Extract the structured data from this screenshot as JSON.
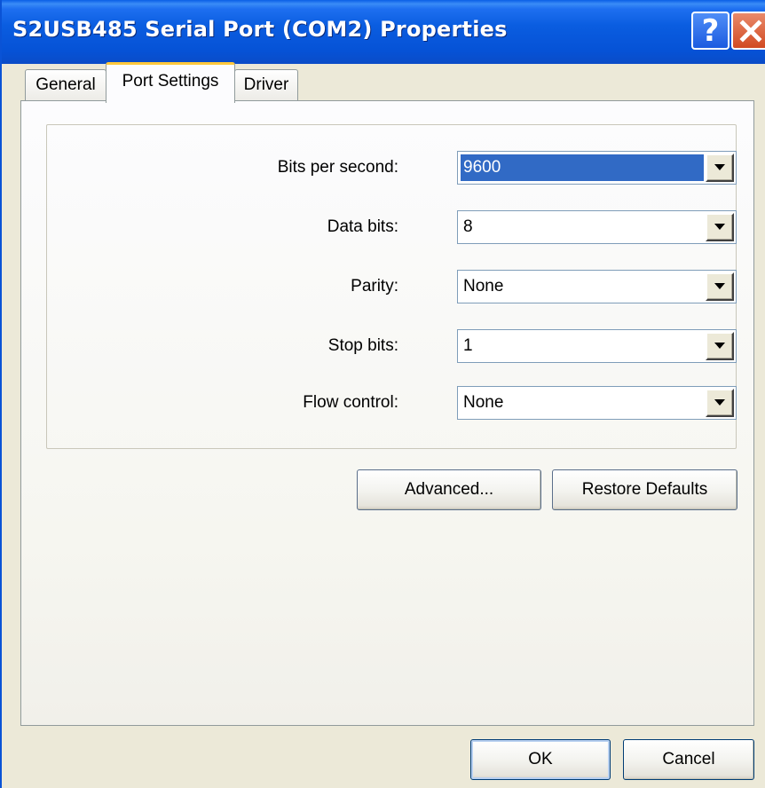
{
  "window": {
    "title": "S2USB485 Serial Port (COM2) Properties",
    "help_icon": "question-mark-icon",
    "close_icon": "close-x-icon",
    "help_symbol": "?"
  },
  "tabs": [
    {
      "label": "General",
      "selected": false
    },
    {
      "label": "Port Settings",
      "selected": true
    },
    {
      "label": "Driver",
      "selected": false
    }
  ],
  "port_settings": {
    "fields": [
      {
        "label": "Bits per second:",
        "value": "9600"
      },
      {
        "label": "Data bits:",
        "value": "8"
      },
      {
        "label": "Parity:",
        "value": "None"
      },
      {
        "label": "Stop bits:",
        "value": "1"
      },
      {
        "label": "Flow control:",
        "value": "None"
      }
    ],
    "advanced_label": "Advanced...",
    "restore_label": "Restore Defaults"
  },
  "dialog_buttons": {
    "ok_label": "OK",
    "cancel_label": "Cancel"
  },
  "colors": {
    "titlebar": "#0A5DE0",
    "selection": "#316AC5",
    "tab_highlight": "#FFC83C",
    "face": "#ECE9D8"
  }
}
